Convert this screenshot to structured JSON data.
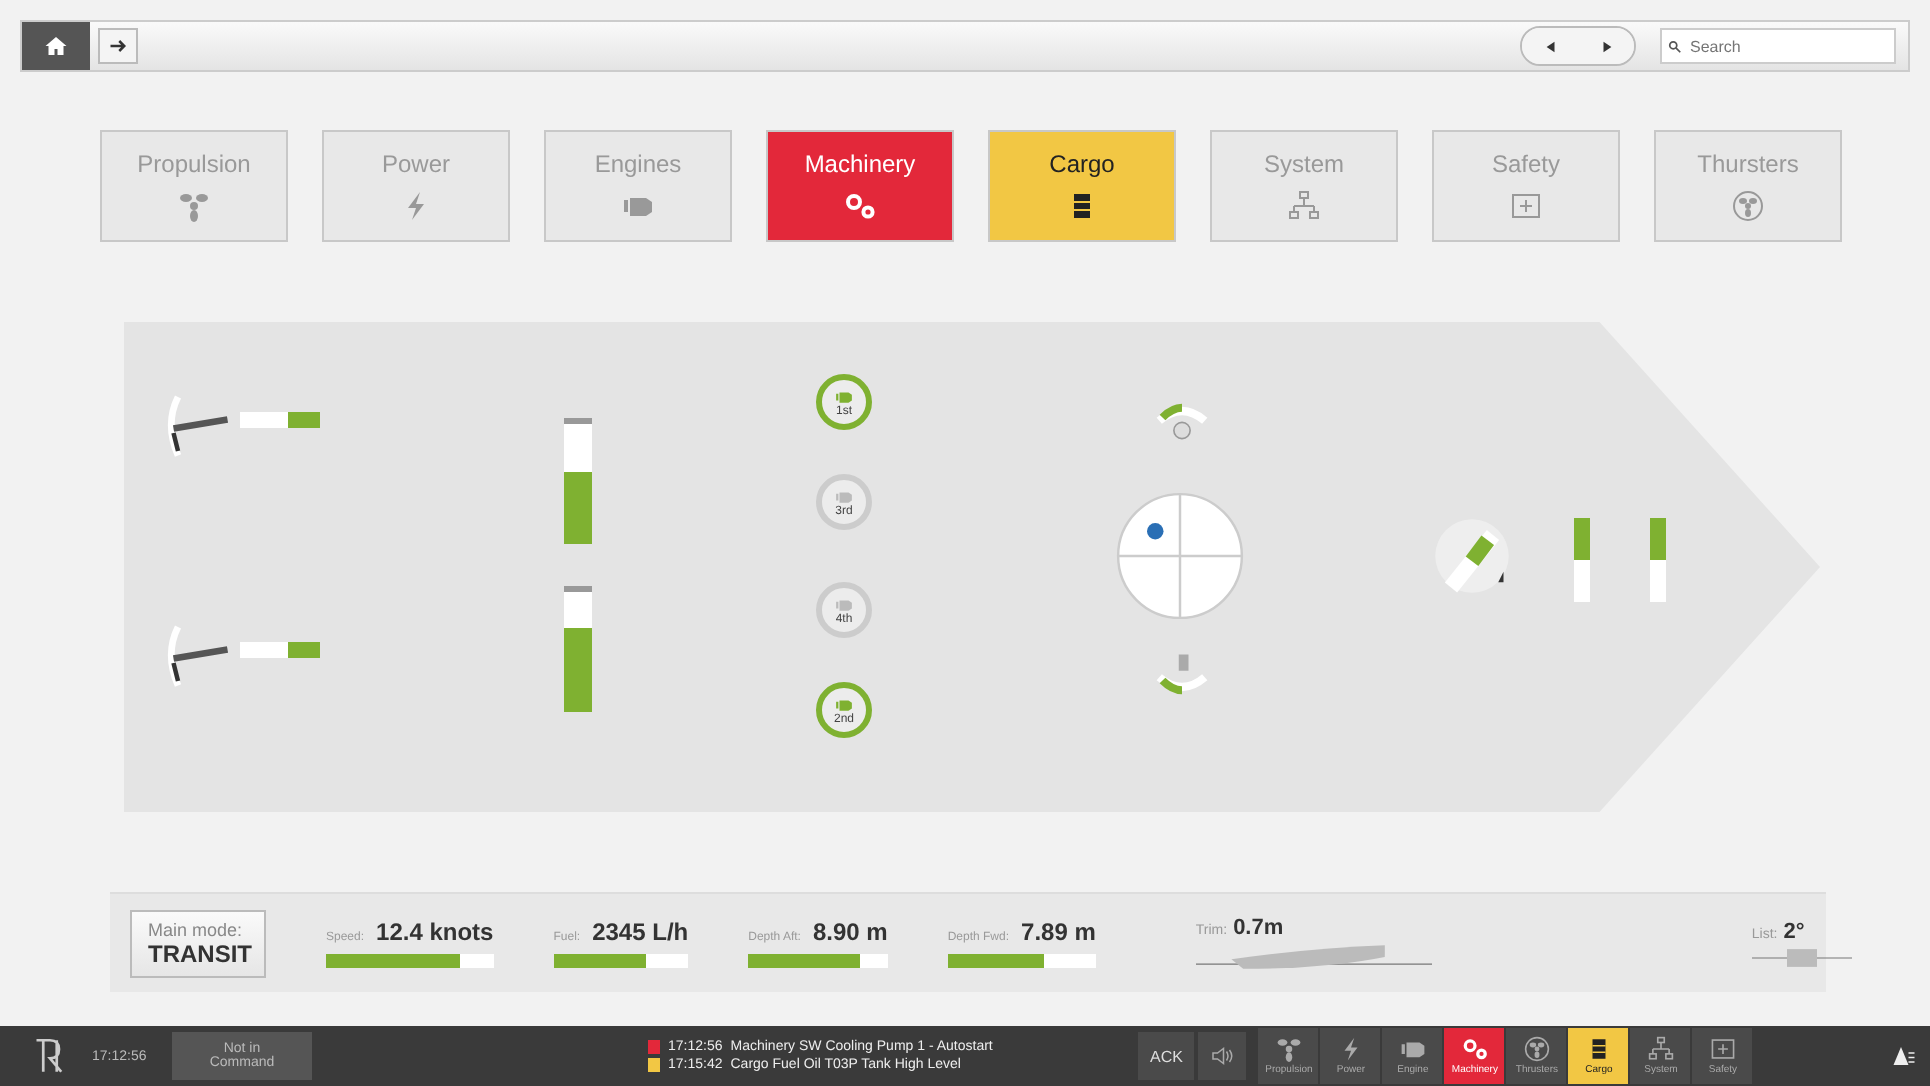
{
  "toolbar": {
    "search": {
      "placeholder": "Search"
    }
  },
  "nav_tabs": [
    {
      "label": "Propulsion",
      "kind": "propeller",
      "color": "#e8e8e8"
    },
    {
      "label": "Power",
      "kind": "bolt",
      "color": "#e8e8e8"
    },
    {
      "label": "Engines",
      "kind": "engine",
      "color": "#e8e8e8"
    },
    {
      "label": "Machinery",
      "kind": "gears",
      "color": "#e3283a"
    },
    {
      "label": "Cargo",
      "kind": "tank",
      "color": "#f2c744"
    },
    {
      "label": "System",
      "kind": "network",
      "color": "#e8e8e8"
    },
    {
      "label": "Safety",
      "kind": "plus",
      "color": "#e8e8e8"
    },
    {
      "label": "Thursters",
      "kind": "fan",
      "color": "#e8e8e8"
    }
  ],
  "ship": {
    "propellers": [
      {
        "level": 0.4
      },
      {
        "level": 0.4
      }
    ],
    "tanks": [
      {
        "level": 0.6
      },
      {
        "level": 0.7
      }
    ],
    "engines": [
      {
        "label": "1st",
        "running": true
      },
      {
        "label": "3rd",
        "running": false
      },
      {
        "label": "4th",
        "running": false
      },
      {
        "label": "2nd",
        "running": true
      }
    ],
    "thrusters": [
      {
        "level": 0.5
      },
      {
        "level": 0.5
      }
    ]
  },
  "info_bar": {
    "mode_label": "Main mode:",
    "mode": "TRANSIT",
    "gauges": [
      {
        "label": "Speed:",
        "value": "12.4 knots",
        "level": 0.8
      },
      {
        "label": "Fuel:",
        "value": "2345 L/h",
        "level": 0.68
      },
      {
        "label": "Depth Aft:",
        "value": "8.90 m",
        "level": 0.8
      },
      {
        "label": "Depth Fwd:",
        "value": "7.89 m",
        "level": 0.65
      }
    ],
    "trim": {
      "label": "Trim:",
      "value": "0.7m"
    },
    "list": {
      "label": "List:",
      "value": "2°"
    }
  },
  "taskbar": {
    "time": "17:12:56",
    "command": [
      "Not in",
      "Command"
    ],
    "alarms": [
      {
        "time": "17:12:56",
        "text": "Machinery SW Cooling Pump 1 - Autostart",
        "color": "#e3283a"
      },
      {
        "time": "17:15:42",
        "text": "Cargo Fuel Oil T03P Tank High Level",
        "color": "#f2c744"
      }
    ],
    "ack": "ACK",
    "apps": [
      {
        "label": "Propulsion",
        "kind": "propeller",
        "color": "#4a4a4a"
      },
      {
        "label": "Power",
        "kind": "bolt",
        "color": "#4a4a4a"
      },
      {
        "label": "Engine",
        "kind": "engine",
        "color": "#4a4a4a"
      },
      {
        "label": "Machinery",
        "kind": "gears",
        "color": "#e3283a"
      },
      {
        "label": "Thrusters",
        "kind": "fan",
        "color": "#4a4a4a"
      },
      {
        "label": "Cargo",
        "kind": "tank",
        "color": "#f2c744"
      },
      {
        "label": "System",
        "kind": "network",
        "color": "#4a4a4a"
      },
      {
        "label": "Safety",
        "kind": "plus",
        "color": "#4a4a4a"
      }
    ]
  }
}
